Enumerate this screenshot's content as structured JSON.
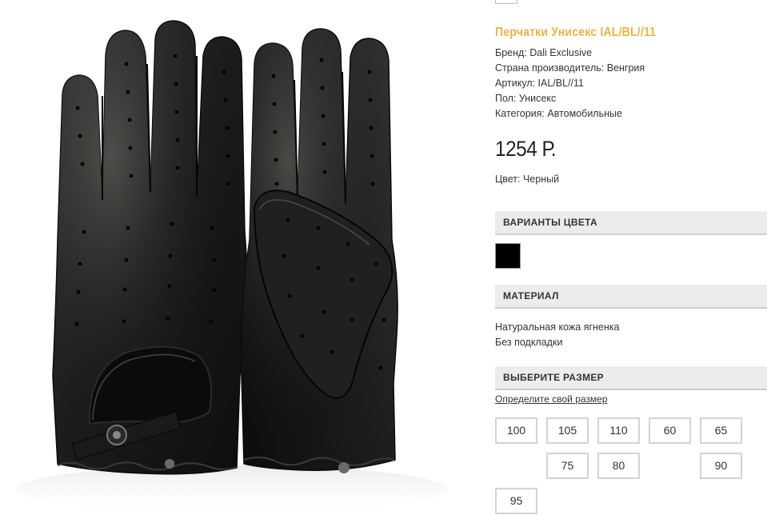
{
  "product": {
    "title": "Перчатки Унисекс IAL/BL//11",
    "attributes": [
      "Бренд: Dali Exclusive",
      "Страна производитель: Венгрия",
      "Артикул: IAL/BL//11",
      "Пол: Унисекс",
      "Категория: Автомобильные"
    ],
    "price": "1254 Р.",
    "color_line": "Цвет: Черный",
    "accent_color": "#e8b34a"
  },
  "color_variants": {
    "heading": "ВАРИАНТЫ ЦВЕТА",
    "swatches": [
      {
        "name": "black",
        "hex": "#000000"
      }
    ]
  },
  "material": {
    "heading": "МАТЕРИАЛ",
    "lines": [
      "Натуральная кожа ягненка",
      "Без подкладки"
    ]
  },
  "sizes": {
    "heading": "ВЫБЕРИТЕ РАЗМЕР",
    "guide_link": "Определите свой размер",
    "options": [
      "100",
      "105",
      "110",
      "60",
      "65",
      "75",
      "80",
      "90",
      "95"
    ]
  },
  "image": {
    "subject": "black perforated leather driving gloves",
    "icon": "product-photo"
  }
}
